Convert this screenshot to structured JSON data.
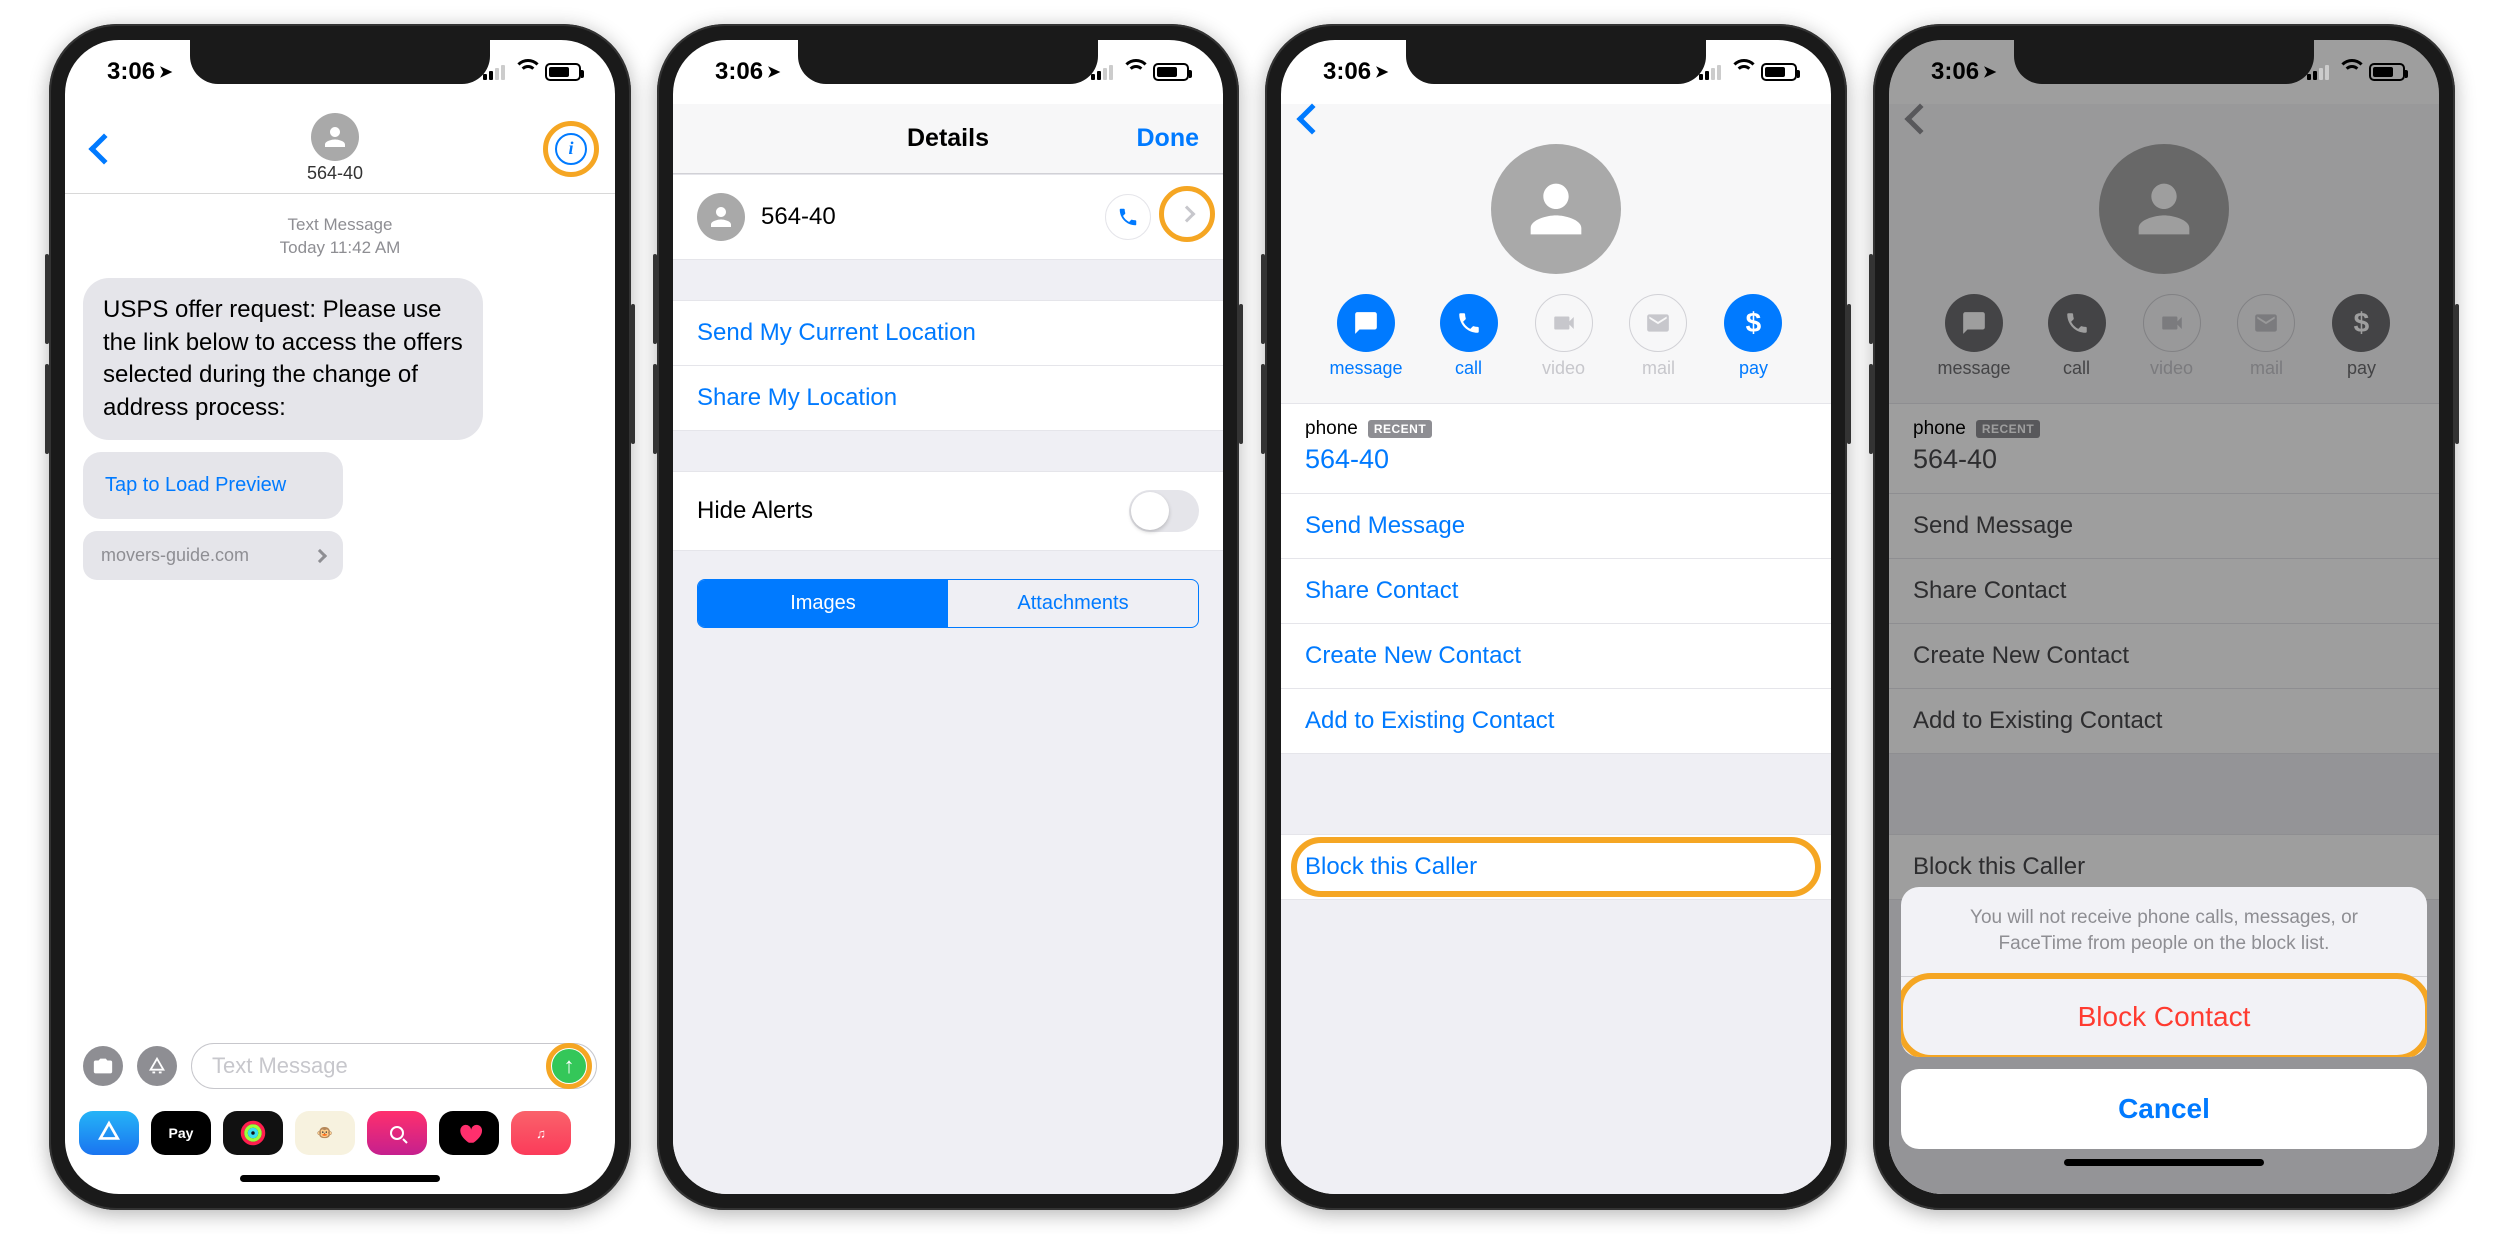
{
  "status": {
    "time": "3:06"
  },
  "screen1": {
    "contact": "564-40",
    "meta_label": "Text Message",
    "meta_day": "Today",
    "meta_time": "11:42 AM",
    "message": "USPS offer request: Please use the link below to access the offers selected during the change of address process:",
    "preview": "Tap to Load Preview",
    "url": "movers-guide.com",
    "placeholder": "Text Message",
    "apps": {
      "pay": "Pay"
    }
  },
  "screen2": {
    "title": "Details",
    "done": "Done",
    "contact": "564-40",
    "send_loc": "Send My Current Location",
    "share_loc": "Share My Location",
    "hide_alerts": "Hide Alerts",
    "seg_images": "Images",
    "seg_attach": "Attachments"
  },
  "screen3": {
    "actions": {
      "message": "message",
      "call": "call",
      "video": "video",
      "mail": "mail",
      "pay": "pay"
    },
    "phone_label": "phone",
    "recent": "RECENT",
    "phone_num": "564-40",
    "send_message": "Send Message",
    "share_contact": "Share Contact",
    "create_contact": "Create New Contact",
    "add_existing": "Add to Existing Contact",
    "block": "Block this Caller"
  },
  "screen4": {
    "sheet_msg": "You will not receive phone calls, messages, or FaceTime from people on the block list.",
    "block_contact": "Block Contact",
    "cancel": "Cancel"
  }
}
